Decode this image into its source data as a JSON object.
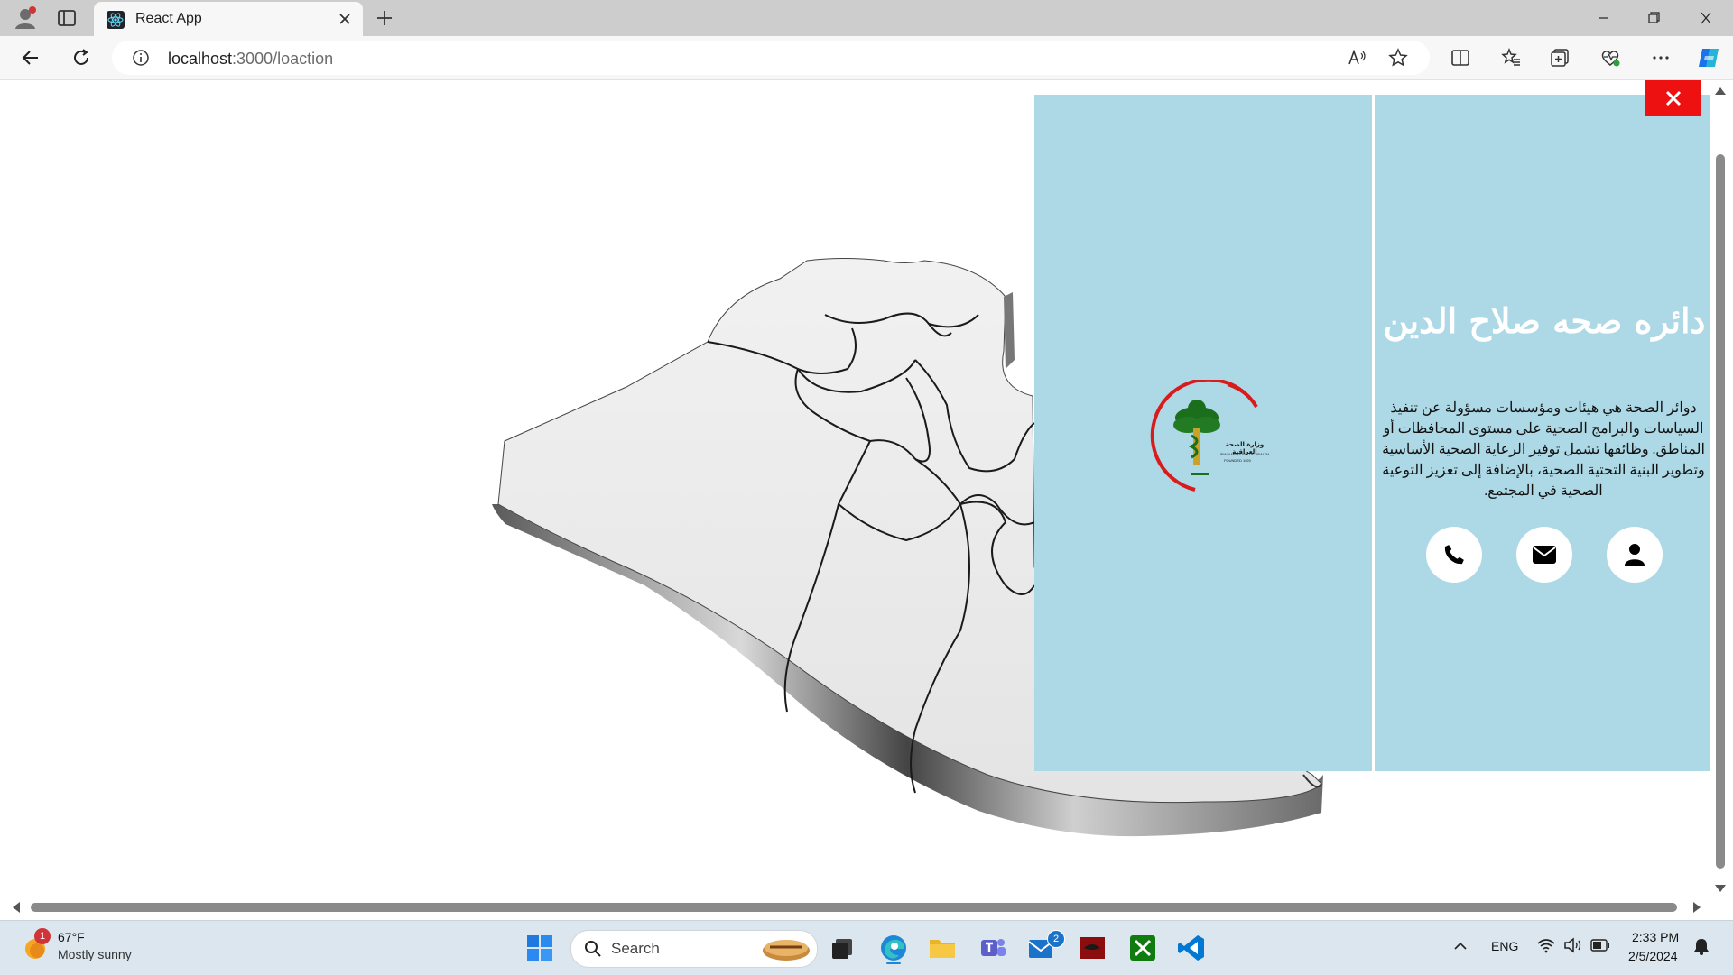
{
  "browser": {
    "tab_title": "React App",
    "url_host": "localhost",
    "url_path": ":3000/loaction"
  },
  "panel": {
    "heading": "دائره صحه صلاح الدين",
    "description": "دوائر الصحة هي هيئات ومؤسسات مسؤولة عن تنفيذ السياسات والبرامج الصحية على مستوى المحافظات أو المناطق. وظائفها تشمل توفير الرعاية الصحية الأساسية وتطوير البنية التحتية الصحية، بالإضافة إلى تعزيز التوعية الصحية في المجتمع.",
    "logo_text_ar": "وزارة الصحة العراقية",
    "logo_text_en": "IRAQI MINISTRY OF HEALTH",
    "logo_founded": "FOUNDED 1920",
    "contact_icons": [
      "phone-icon",
      "envelope-icon",
      "user-icon"
    ],
    "colors": {
      "panel_bg": "#add8e6",
      "close_bg": "#ee1111",
      "heading": "#ffffff"
    }
  },
  "taskbar": {
    "weather_temp": "67°F",
    "weather_cond": "Mostly sunny",
    "weather_badge": "1",
    "search_label": "Search",
    "mail_badge": "2",
    "lang": "ENG",
    "time": "2:33 PM",
    "date": "2/5/2024"
  }
}
